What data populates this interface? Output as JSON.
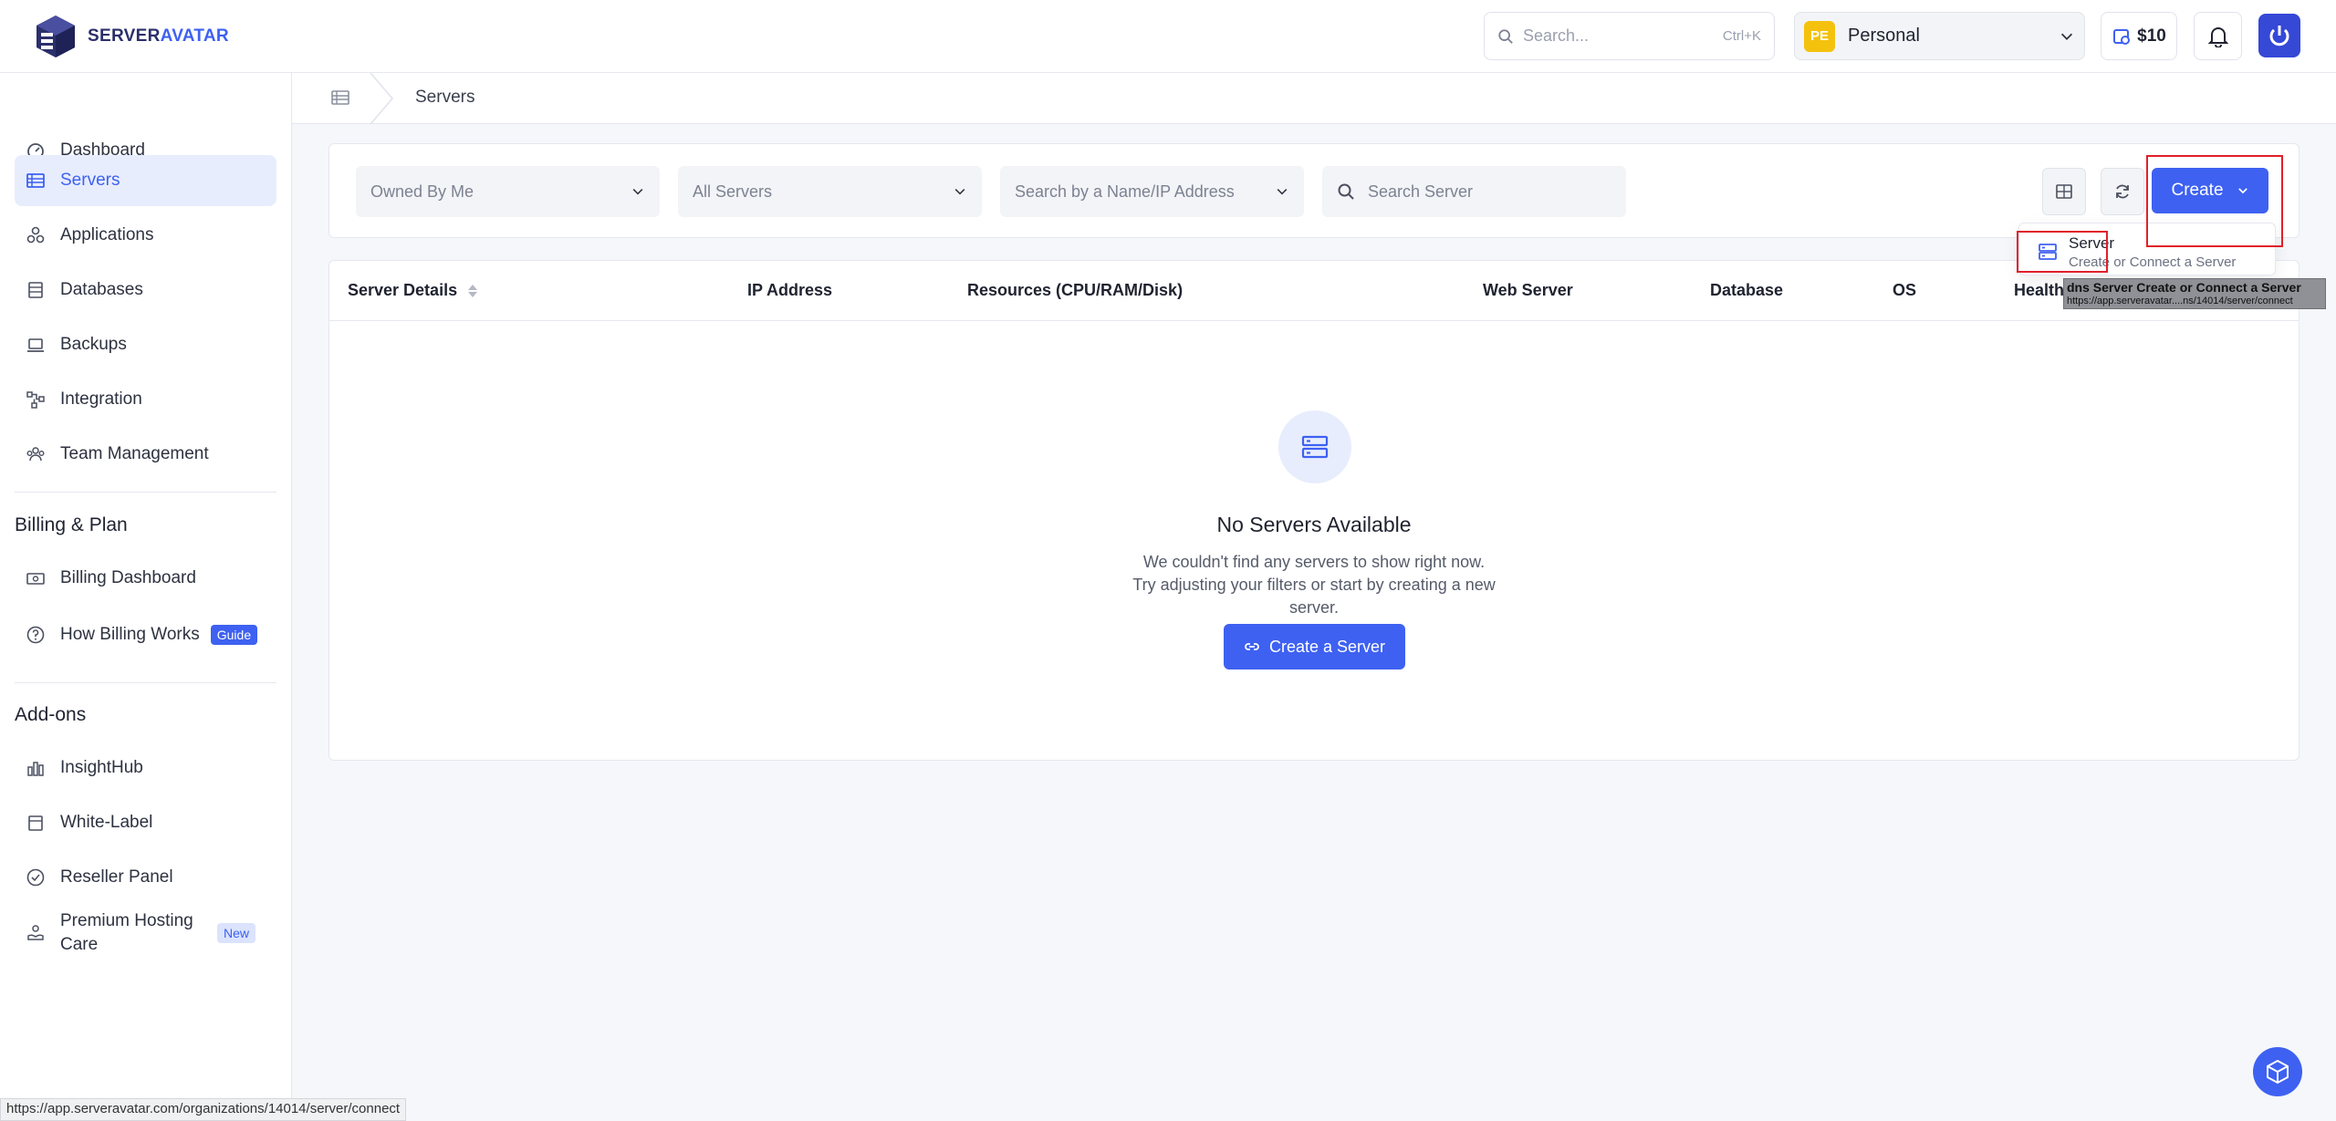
{
  "brand": {
    "name_part1": "SERVER",
    "name_part2": "AVATAR"
  },
  "header": {
    "search_placeholder": "Search...",
    "search_shortcut": "Ctrl+K",
    "workspace_badge": "PE",
    "workspace_name": "Personal",
    "credit": "$10"
  },
  "sidebar": {
    "items": [
      {
        "label": "Dashboard",
        "icon": "gauge-icon"
      },
      {
        "label": "Servers",
        "icon": "server-list-icon",
        "active": true
      },
      {
        "label": "Applications",
        "icon": "apps-icon"
      },
      {
        "label": "Databases",
        "icon": "database-icon"
      },
      {
        "label": "Backups",
        "icon": "backup-icon"
      },
      {
        "label": "Integration",
        "icon": "integration-icon"
      },
      {
        "label": "Team Management",
        "icon": "team-icon"
      }
    ],
    "billing_title": "Billing & Plan",
    "billing_items": [
      {
        "label": "Billing Dashboard",
        "icon": "billing-icon"
      },
      {
        "label": "How Billing Works",
        "icon": "help-circle-icon",
        "tag": "Guide"
      }
    ],
    "addons_title": "Add-ons",
    "addon_items": [
      {
        "label": "InsightHub",
        "icon": "chart-bars-icon"
      },
      {
        "label": "White-Label",
        "icon": "label-icon"
      },
      {
        "label": "Reseller Panel",
        "icon": "check-circle-icon"
      },
      {
        "label": "Premium Hosting Care",
        "icon": "care-icon",
        "tag": "New"
      }
    ]
  },
  "breadcrumb": {
    "current": "Servers"
  },
  "filters": {
    "owner": "Owned By Me",
    "server_type": "All Servers",
    "search_name_ip": "Search by a Name/IP Address",
    "search_server_placeholder": "Search Server",
    "create_label": "Create"
  },
  "table": {
    "headers": [
      "Server Details",
      "IP Address",
      "Resources (CPU/RAM/Disk)",
      "Web Server",
      "Database",
      "OS",
      "Health"
    ],
    "empty_title": "No Servers Available",
    "empty_desc": "We couldn't find any servers to show right now. Try adjusting your filters or start by creating a new server.",
    "empty_button": "Create a Server"
  },
  "dropdown": {
    "title": "Server",
    "subtitle": "Create or Connect a Server"
  },
  "tooltip": {
    "line1": "dns  Server Create or Connect a Server",
    "line2": "https://app.serveravatar....ns/14014/server/connect"
  },
  "status_url": "https://app.serveravatar.com/organizations/14014/server/connect",
  "colors": {
    "accent": "#3e61f1",
    "highlight": "#e0202a",
    "workspace_badge": "#f4c20d"
  }
}
